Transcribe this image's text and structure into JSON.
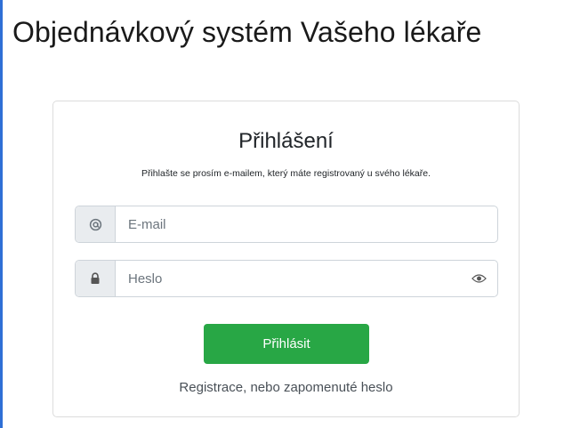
{
  "page": {
    "title": "Objednávkový systém Vašeho lékaře"
  },
  "login": {
    "title": "Přihlášení",
    "subtitle": "Přihlašte se prosím e-mailem, který máte registrovaný u svého lékaře.",
    "email": {
      "placeholder": "E-mail",
      "value": "",
      "icon": "at-icon"
    },
    "password": {
      "placeholder": "Heslo",
      "value": "",
      "icon": "lock-icon",
      "toggle_icon": "eye-icon"
    },
    "submit_label": "Přihlásit",
    "register_link": "Registrace, nebo zapomenuté heslo"
  },
  "colors": {
    "accent_bar": "#2e6fd6",
    "button": "#28a745",
    "addon_bg": "#e9ecef",
    "border": "#ced4da"
  }
}
